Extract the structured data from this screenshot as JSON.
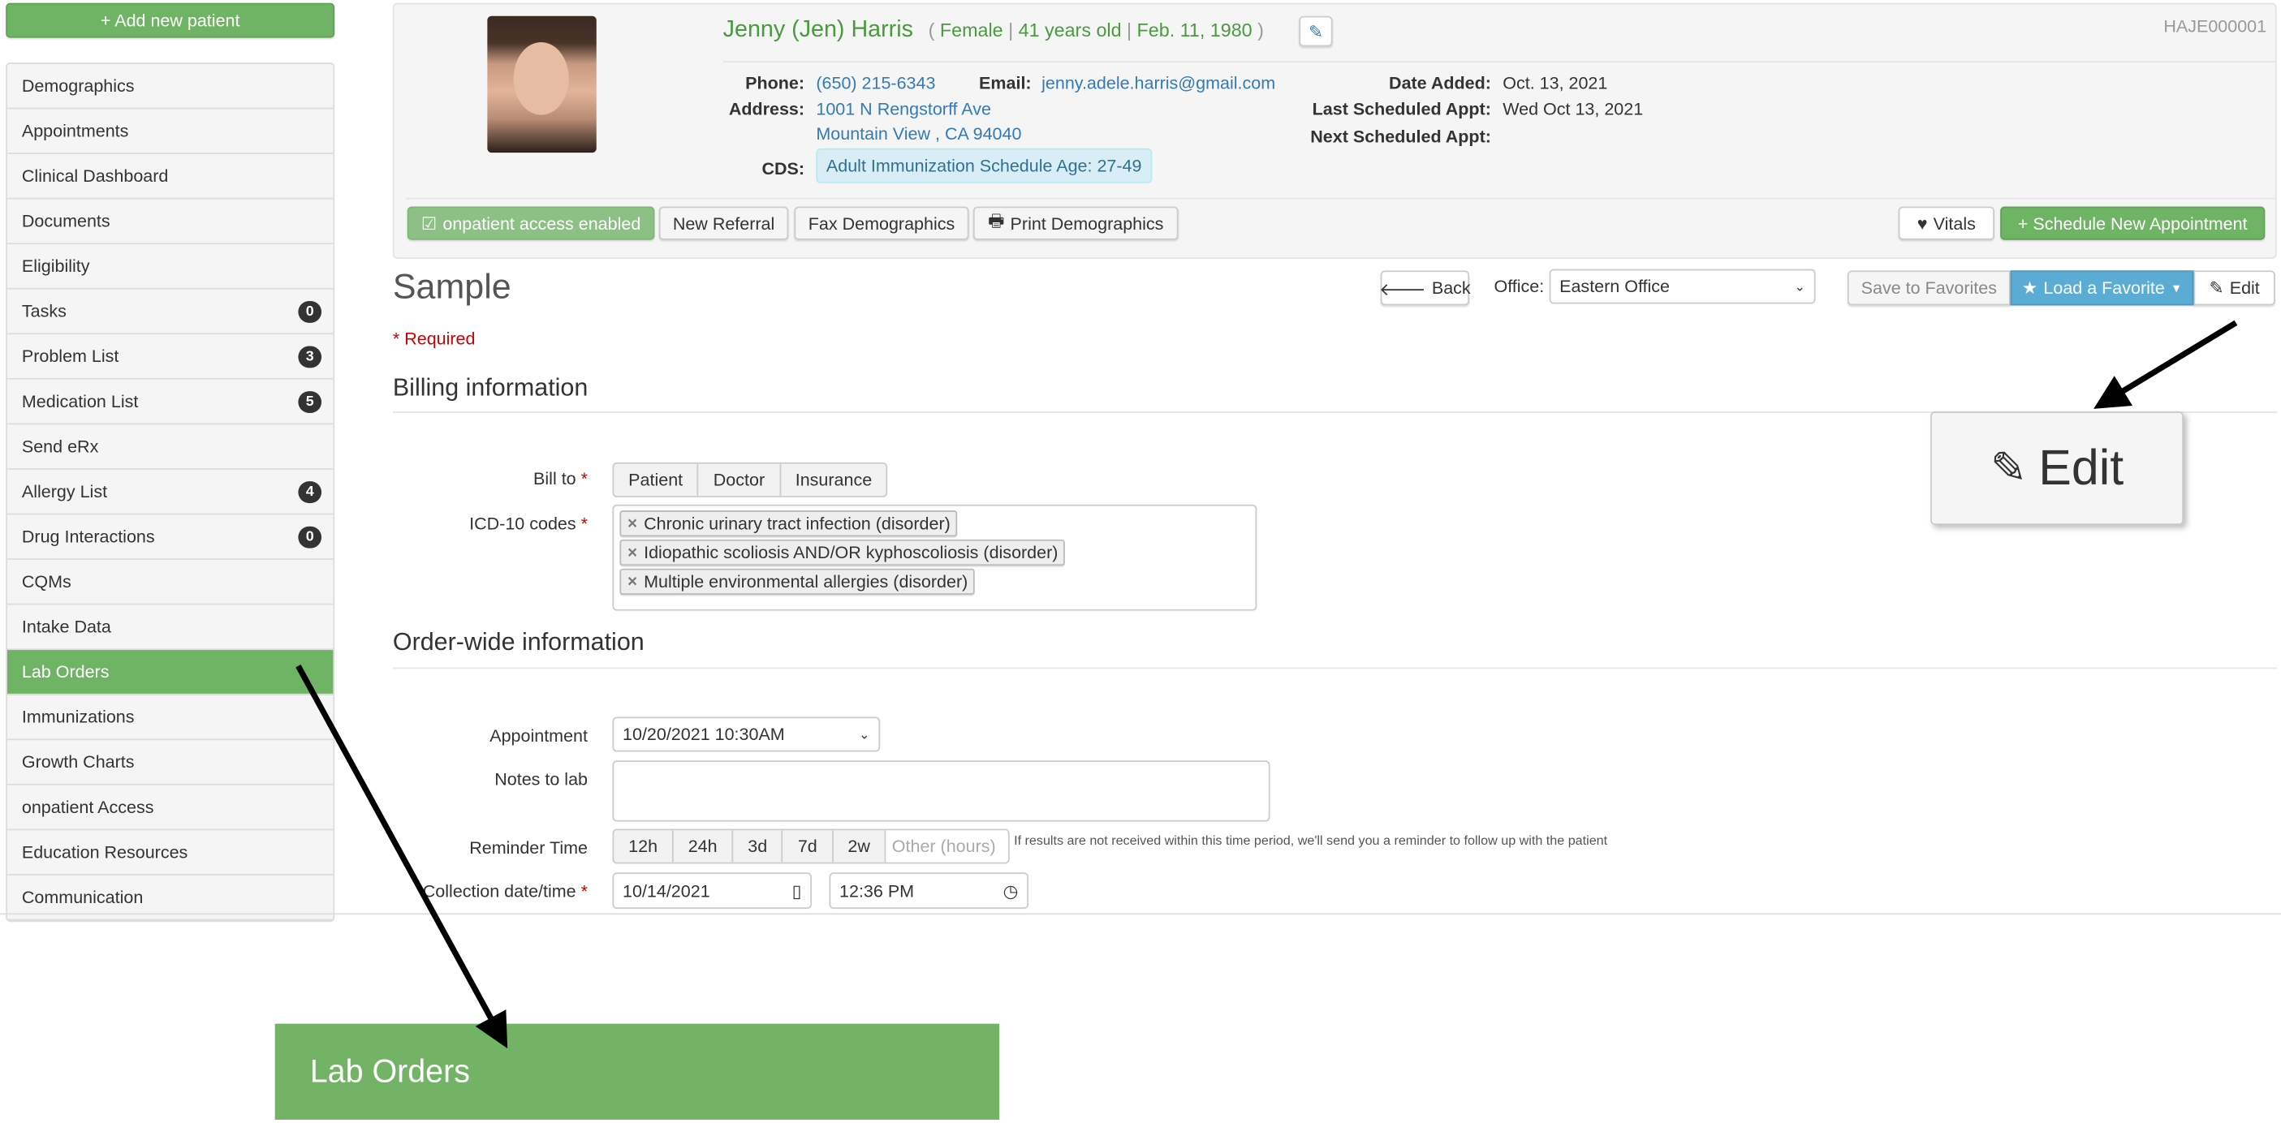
{
  "sidebar": {
    "add_patient_label": "+ Add new patient",
    "items": [
      {
        "label": "Demographics"
      },
      {
        "label": "Appointments"
      },
      {
        "label": "Clinical Dashboard"
      },
      {
        "label": "Documents"
      },
      {
        "label": "Eligibility"
      },
      {
        "label": "Tasks",
        "badge": "0"
      },
      {
        "label": "Problem List",
        "badge": "3"
      },
      {
        "label": "Medication List",
        "badge": "5"
      },
      {
        "label": "Send eRx"
      },
      {
        "label": "Allergy List",
        "badge": "4"
      },
      {
        "label": "Drug Interactions",
        "badge": "0"
      },
      {
        "label": "CQMs"
      },
      {
        "label": "Intake Data"
      },
      {
        "label": "Lab Orders",
        "active": true
      },
      {
        "label": "Immunizations"
      },
      {
        "label": "Growth Charts"
      },
      {
        "label": "onpatient Access"
      },
      {
        "label": "Education Resources"
      },
      {
        "label": "Communication"
      }
    ]
  },
  "patient": {
    "name": "Jenny (Jen) Harris",
    "gender": "Female",
    "age": "41 years old",
    "dob": "Feb. 11, 1980",
    "chart_id": "HAJE000001",
    "phone_label": "Phone:",
    "phone": "(650) 215-6343",
    "email_label": "Email:",
    "email": "jenny.adele.harris@gmail.com",
    "address_label": "Address:",
    "address1": "1001 N Rengstorff Ave",
    "address2": "Mountain View , CA 94040",
    "cds_label": "CDS:",
    "cds": "Adult Immunization Schedule Age: 27-49",
    "date_added_label": "Date Added:",
    "date_added": "Oct. 13, 2021",
    "last_appt_label": "Last Scheduled Appt:",
    "last_appt": "Wed Oct 13, 2021",
    "next_appt_label": "Next Scheduled Appt:"
  },
  "header_actions": {
    "onpatient": "onpatient access enabled",
    "new_referral": "New Referral",
    "fax": "Fax Demographics",
    "print": "Print Demographics",
    "vitals": "Vitals",
    "schedule": "+ Schedule New Appointment"
  },
  "toolbar": {
    "title": "Sample",
    "back": "Back",
    "office_label": "Office:",
    "office_value": "Eastern Office",
    "save_favorites": "Save to Favorites",
    "load_favorite": "Load a Favorite",
    "edit": "Edit"
  },
  "form": {
    "required_note": "* Required",
    "billing_heading": "Billing information",
    "bill_to_label": "Bill to",
    "bill_to_options": [
      "Patient",
      "Doctor",
      "Insurance"
    ],
    "icd_label": "ICD-10 codes",
    "icd_codes": [
      "Chronic urinary tract infection (disorder)",
      "Idiopathic scoliosis AND/OR kyphoscoliosis (disorder)",
      "Multiple environmental allergies (disorder)"
    ],
    "order_heading": "Order-wide information",
    "appointment_label": "Appointment",
    "appointment_value": "10/20/2021 10:30AM",
    "notes_label": "Notes to lab",
    "reminder_label": "Reminder Time",
    "reminder_options": [
      "12h",
      "24h",
      "3d",
      "7d",
      "2w"
    ],
    "reminder_other_placeholder": "Other (hours)",
    "reminder_help": "If results are not received within this time period, we'll send you a reminder to follow up with the patient",
    "collection_label": "Collection date/time",
    "collection_date": "10/14/2021",
    "collection_time": "12:36 PM"
  },
  "callouts": {
    "edit": "Edit",
    "lab_orders": "Lab Orders"
  },
  "colors": {
    "green": "#6fb464",
    "blue": "#5bacd4",
    "link": "#337ab7"
  }
}
